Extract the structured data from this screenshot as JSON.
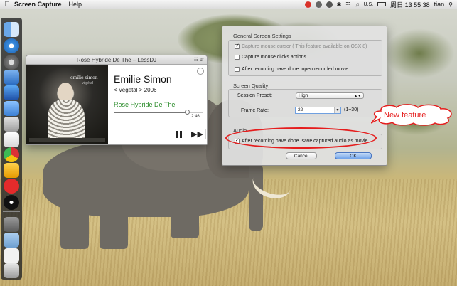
{
  "menubar": {
    "app_name": "Screen Capture",
    "menus": [
      "Help"
    ],
    "input_source": "U.S.",
    "clock": "周日 13 55 38",
    "user": "tian"
  },
  "player": {
    "window_title": "Rose Hybride De The – LessDJ",
    "artist": "Emilie Simon",
    "album_line": "< Vegetal > 2006",
    "track": "Rose Hybride De The",
    "elapsed": "2:46",
    "progress": 0.82,
    "album_art_text": "emilie simon",
    "album_art_subtext": "végétal"
  },
  "prefs": {
    "general_title": "General Screen Settings",
    "capture_cursor": "Capture mouse cursor  ( This feature available on OSX.8)",
    "capture_clicks": "Capture mouse clicks actions",
    "open_after": "After recording have done ,open recorded movie",
    "quality_title": "Screen  Quality:",
    "preset_label": "Session Preset:",
    "preset_value": "High",
    "rate_label": "Frame Rate:",
    "rate_value": "22",
    "rate_range": "(1~30)",
    "audio_title": "Audio",
    "audio_option": "After recording have done ,save captured audio as movie",
    "cancel": "Cancel",
    "ok": "OK"
  },
  "annotation": {
    "text": "New feature",
    "color": "#e51d1d"
  },
  "dock_icons": [
    "finder-icon",
    "safari-icon",
    "launchpad-icon",
    "mail-icon",
    "xcode-icon",
    "preview-icon",
    "photo-icon",
    "textedit-icon",
    "chrome-icon",
    "pencil-icon",
    "facetime-icon",
    "screen-capture-icon",
    "folder-icon",
    "downloads-icon",
    "document-icon",
    "trash-icon"
  ]
}
